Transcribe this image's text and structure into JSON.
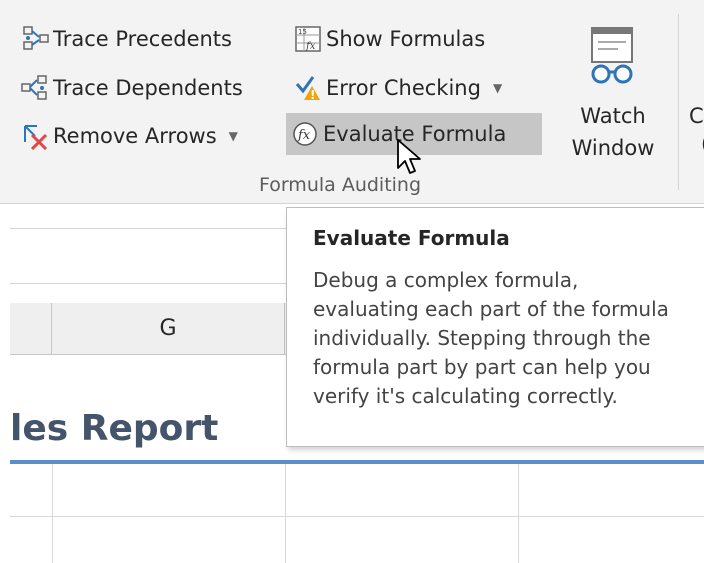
{
  "ribbon": {
    "commands": {
      "trace_precedents": "Trace Precedents",
      "trace_dependents": "Trace Dependents",
      "remove_arrows": "Remove Arrows",
      "show_formulas": "Show Formulas",
      "error_checking": "Error Checking",
      "evaluate_formula": "Evaluate Formula"
    },
    "watch_window": {
      "line1": "Watch",
      "line2": "Window"
    },
    "next_group_cut": {
      "line1": "C",
      "line2": "("
    },
    "group_label": "Formula Auditing",
    "dropdown_glyph": "▼"
  },
  "sheet": {
    "column_headers": [
      "G"
    ],
    "title_fragment": "les Report"
  },
  "tooltip": {
    "title": "Evaluate Formula",
    "lines": [
      "Debug a complex formula,",
      "evaluating each part of the formula",
      "individually. Stepping through the",
      "formula part by part can help you",
      "verify it's calculating correctly."
    ]
  },
  "colors": {
    "accent": "#5b8fc9",
    "title_text": "#44546a",
    "hover_bg": "#c6c6c6",
    "error_icon": "#f0a30a",
    "remove_arrow_red": "#e04848",
    "arrow_blue": "#2e75b6"
  },
  "icons": {
    "trace_precedents": "trace-precedents-icon",
    "trace_dependents": "trace-dependents-icon",
    "remove_arrows": "remove-arrows-icon",
    "show_formulas": "show-formulas-icon",
    "error_checking": "error-checking-icon",
    "evaluate_formula": "evaluate-formula-icon",
    "watch_window": "watch-window-icon",
    "cursor": "mouse-pointer-icon"
  }
}
